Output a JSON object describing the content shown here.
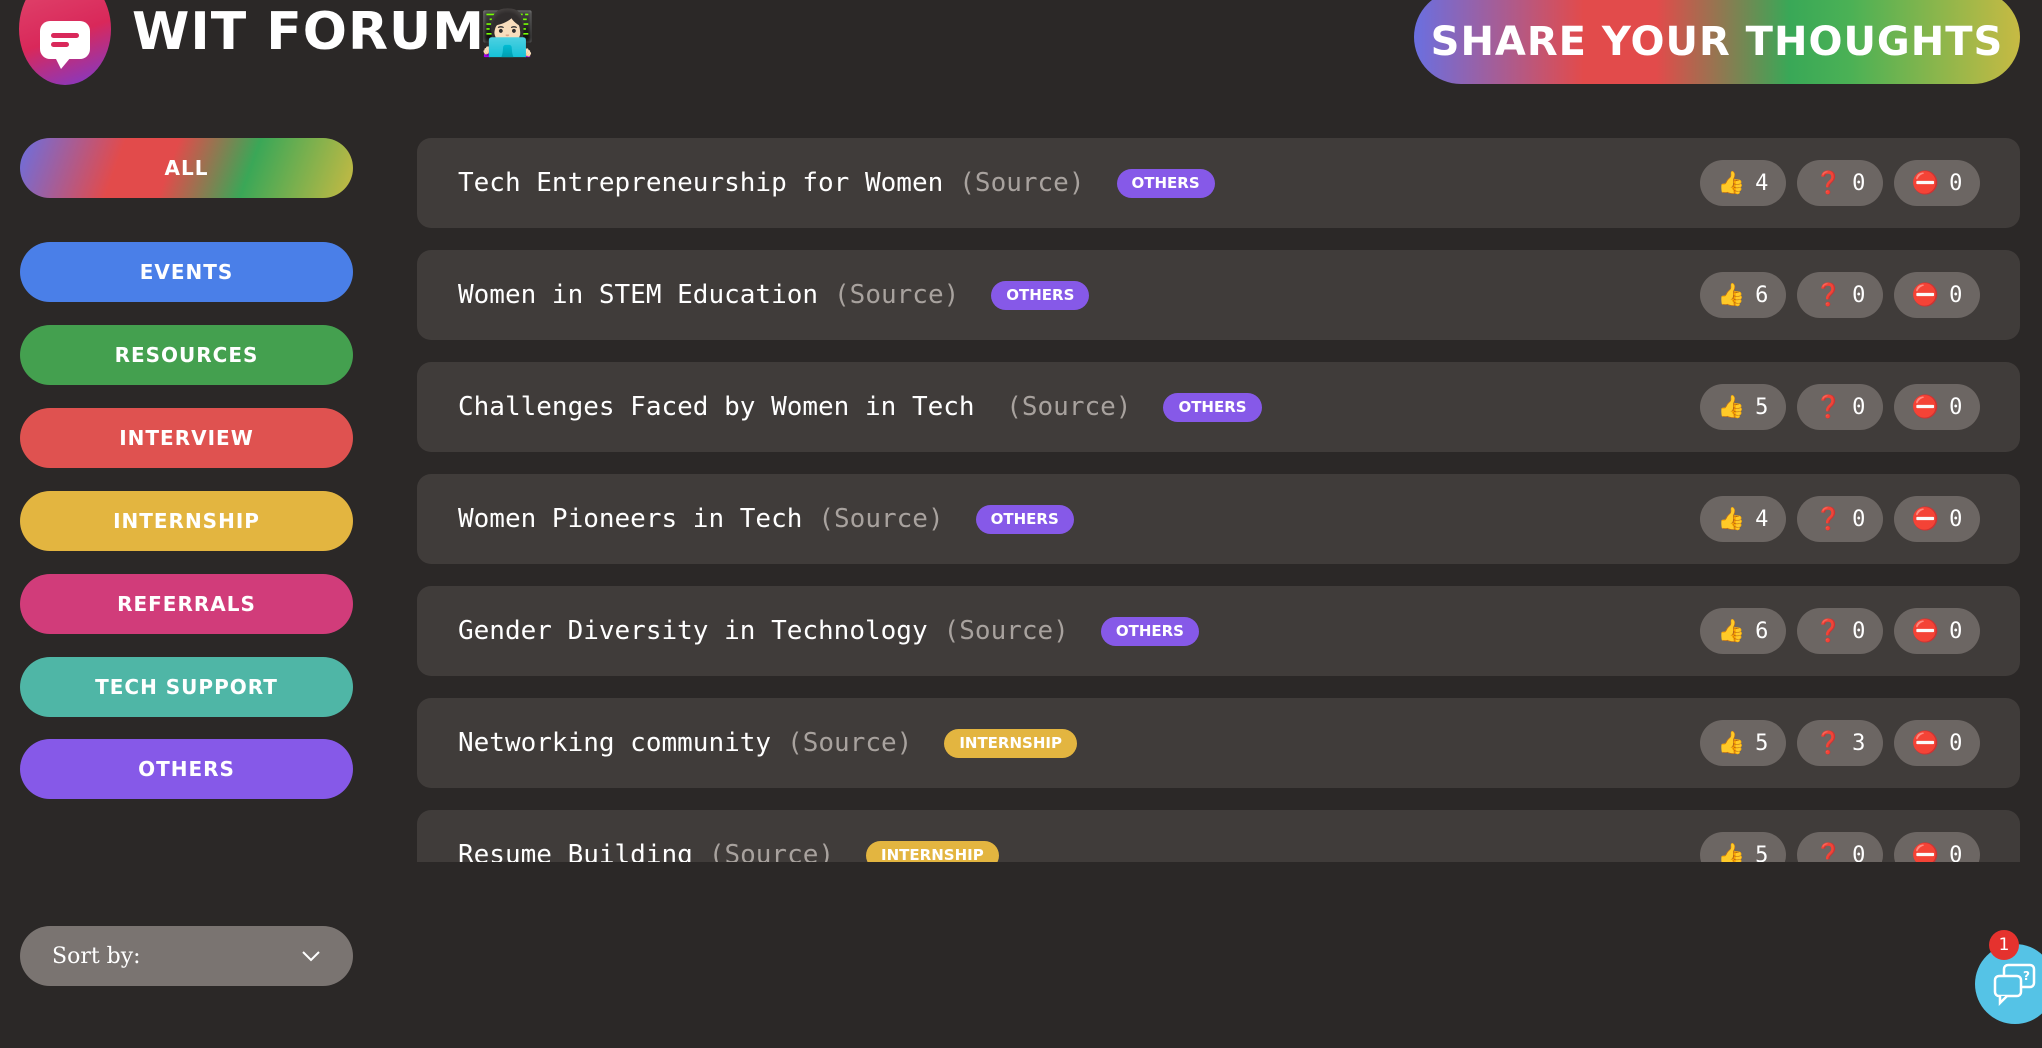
{
  "header": {
    "brand": "WIT FORUM",
    "brand_emoji": "👩🏻‍💻",
    "share_label": "SHARE YOUR THOUGHTS",
    "logo_icon": "chat-bubble-icon"
  },
  "sidebar": {
    "items": [
      {
        "label": "ALL",
        "color": "gradient"
      },
      {
        "label": "EVENTS",
        "color": "#4a7fe8"
      },
      {
        "label": "RESOURCES",
        "color": "#44a04f"
      },
      {
        "label": "INTERVIEW",
        "color": "#df5250"
      },
      {
        "label": "INTERNSHIP",
        "color": "#e3b540"
      },
      {
        "label": "REFERRALS",
        "color": "#d13c7a"
      },
      {
        "label": "TECH SUPPORT",
        "color": "#4fb6a6"
      },
      {
        "label": "OTHERS",
        "color": "#8659e8"
      }
    ],
    "sort_label": "Sort by:"
  },
  "posts": [
    {
      "title": "Tech Entrepreneurship for Women",
      "source": "(Source)",
      "tag": "OTHERS",
      "tag_color": "#8659e8",
      "likes": "4",
      "questions": "0",
      "noentry": "0"
    },
    {
      "title": "Women in STEM Education",
      "source": "(Source)",
      "tag": "OTHERS",
      "tag_color": "#8659e8",
      "likes": "6",
      "questions": "0",
      "noentry": "0"
    },
    {
      "title": "Challenges Faced by Women in Tech ",
      "source": "(Source)",
      "tag": "OTHERS",
      "tag_color": "#8659e8",
      "likes": "5",
      "questions": "0",
      "noentry": "0"
    },
    {
      "title": "Women Pioneers in Tech",
      "source": "(Source)",
      "tag": "OTHERS",
      "tag_color": "#8659e8",
      "likes": "4",
      "questions": "0",
      "noentry": "0"
    },
    {
      "title": "Gender Diversity in Technology",
      "source": "(Source)",
      "tag": "OTHERS",
      "tag_color": "#8659e8",
      "likes": "6",
      "questions": "0",
      "noentry": "0"
    },
    {
      "title": "Networking community",
      "source": "(Source)",
      "tag": "INTERNSHIP",
      "tag_color": "#e3b540",
      "likes": "5",
      "questions": "3",
      "noentry": "0"
    },
    {
      "title": "Resume Building",
      "source": "(Source)",
      "tag": "INTERNSHIP",
      "tag_color": "#e3b540",
      "likes": "5",
      "questions": "0",
      "noentry": "0"
    }
  ],
  "reaction_icons": {
    "like": "👍",
    "question": "❓",
    "noentry": "⛔"
  },
  "help": {
    "badge": "1",
    "icon": "help-chat-icon"
  }
}
